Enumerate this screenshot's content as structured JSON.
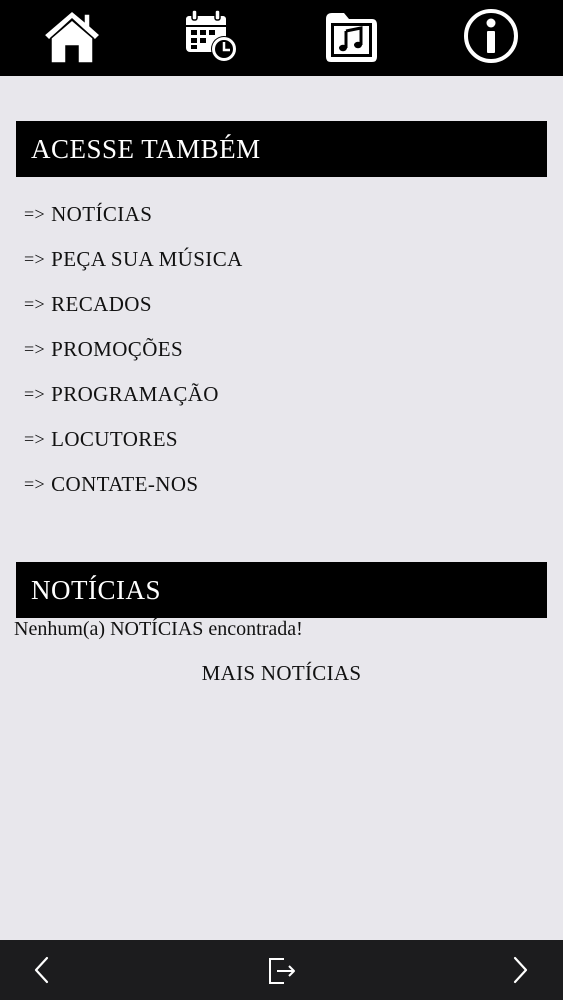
{
  "topbar": {
    "icons": {
      "home": "home-icon",
      "schedule": "calendar-clock-icon",
      "music": "music-folder-icon",
      "info": "info-icon"
    }
  },
  "acesse": {
    "title": "ACESSE TAMBÉM",
    "arrow": "=>",
    "links": [
      "NOTÍCIAS",
      "PEÇA SUA MÚSICA",
      "RECADOS",
      "PROMOÇÕES",
      "PROGRAMAÇÃO",
      "LOCUTORES",
      "CONTATE-NOS"
    ]
  },
  "noticias": {
    "title": "NOTÍCIAS",
    "empty_message": "Nenhum(a) NOTÍCIAS encontrada!",
    "more_label": "MAIS NOTÍCIAS"
  },
  "bottombar": {
    "icons": {
      "back": "chevron-left-icon",
      "share": "share-exit-icon",
      "forward": "chevron-right-icon"
    }
  },
  "colors": {
    "background": "#e8e7ec",
    "header_bg": "#000000",
    "header_text": "#ffffff",
    "bottombar_bg": "#1c1c1e"
  }
}
